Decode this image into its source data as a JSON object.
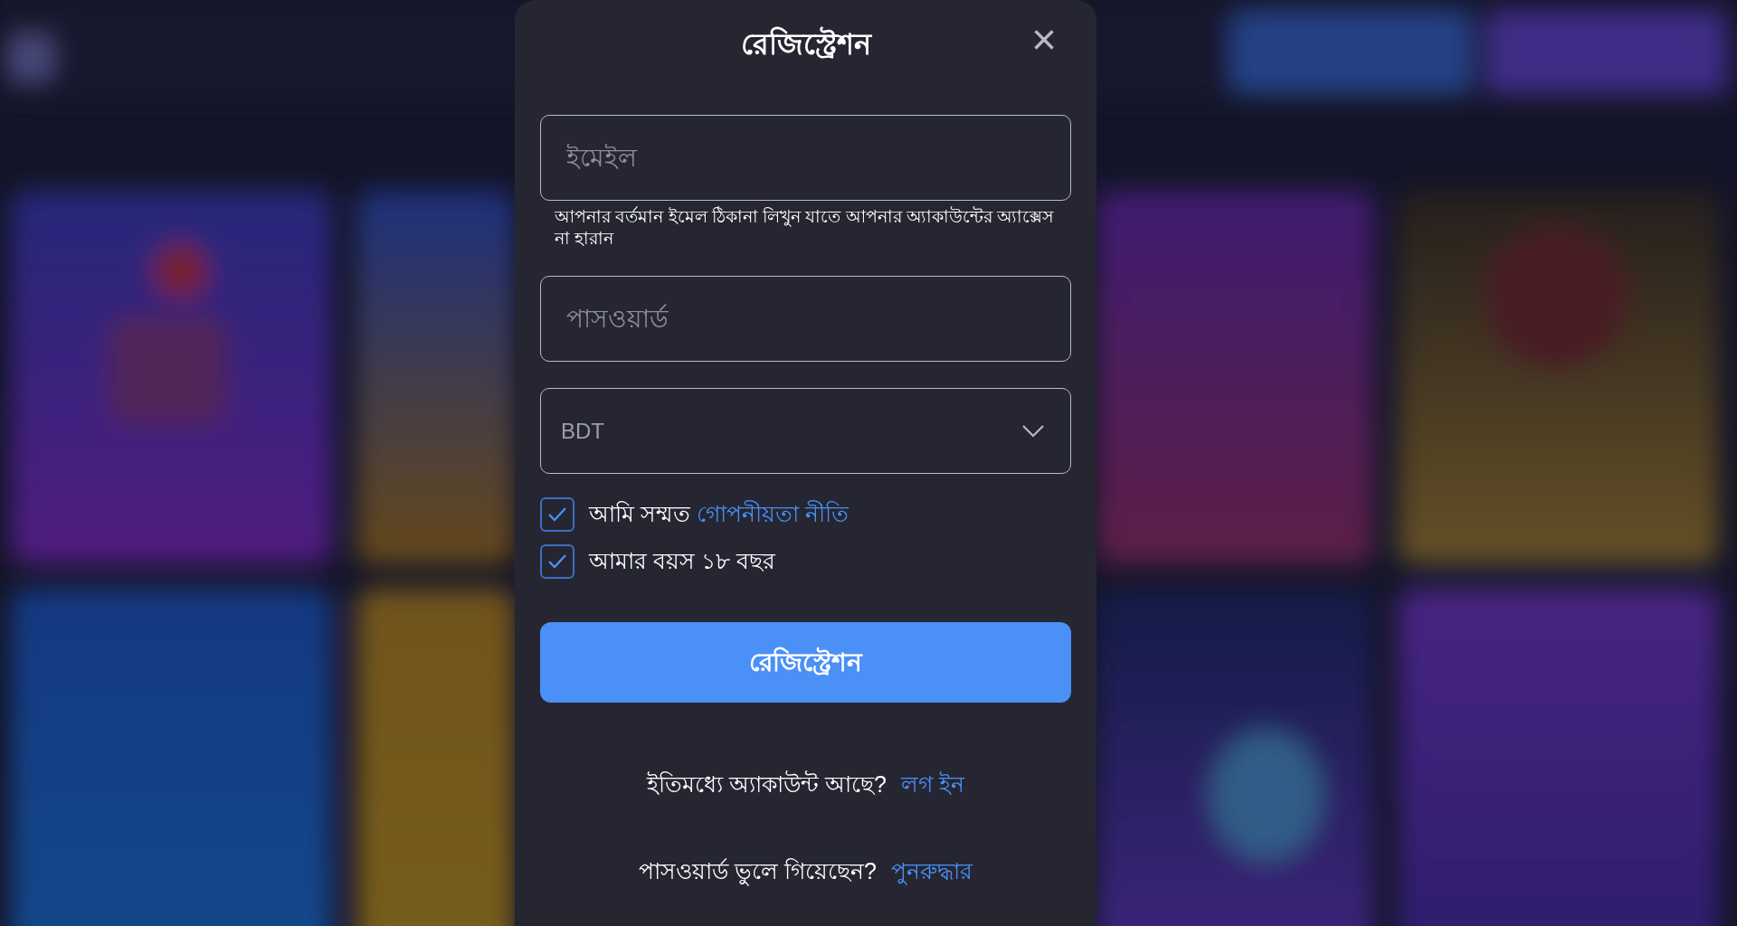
{
  "dialog": {
    "title": "রেজিস্ট্রেশন",
    "close": "×"
  },
  "fields": [
    {
      "kind": "text",
      "placeholder": "ইমেইল",
      "hint": "আপনার বর্তমান ইমেল ঠিকানা লিখুন যাতে আপনার অ্যাকাউন্টের অ্যাক্সেস না হারান"
    },
    {
      "kind": "password",
      "placeholder": "পাসওয়ার্ড"
    },
    {
      "kind": "select",
      "value": "BDT"
    }
  ],
  "checkboxes": [
    {
      "label": "আমি সম্মত",
      "link": "গোপনীয়তা নীতি",
      "checked": true
    },
    {
      "label": "আমার বয়স ১৮ বছর",
      "checked": true
    }
  ],
  "submit": "রেজিস্ট্রেশন",
  "footer": [
    {
      "text": "ইতিমধ্যে অ্যাকাউন্ট আছে?",
      "link": "লগ ইন"
    },
    {
      "text": "পাসওয়ার্ড ভুলে গিয়েছেন?",
      "link": "পুনরুদ্ধার"
    }
  ]
}
